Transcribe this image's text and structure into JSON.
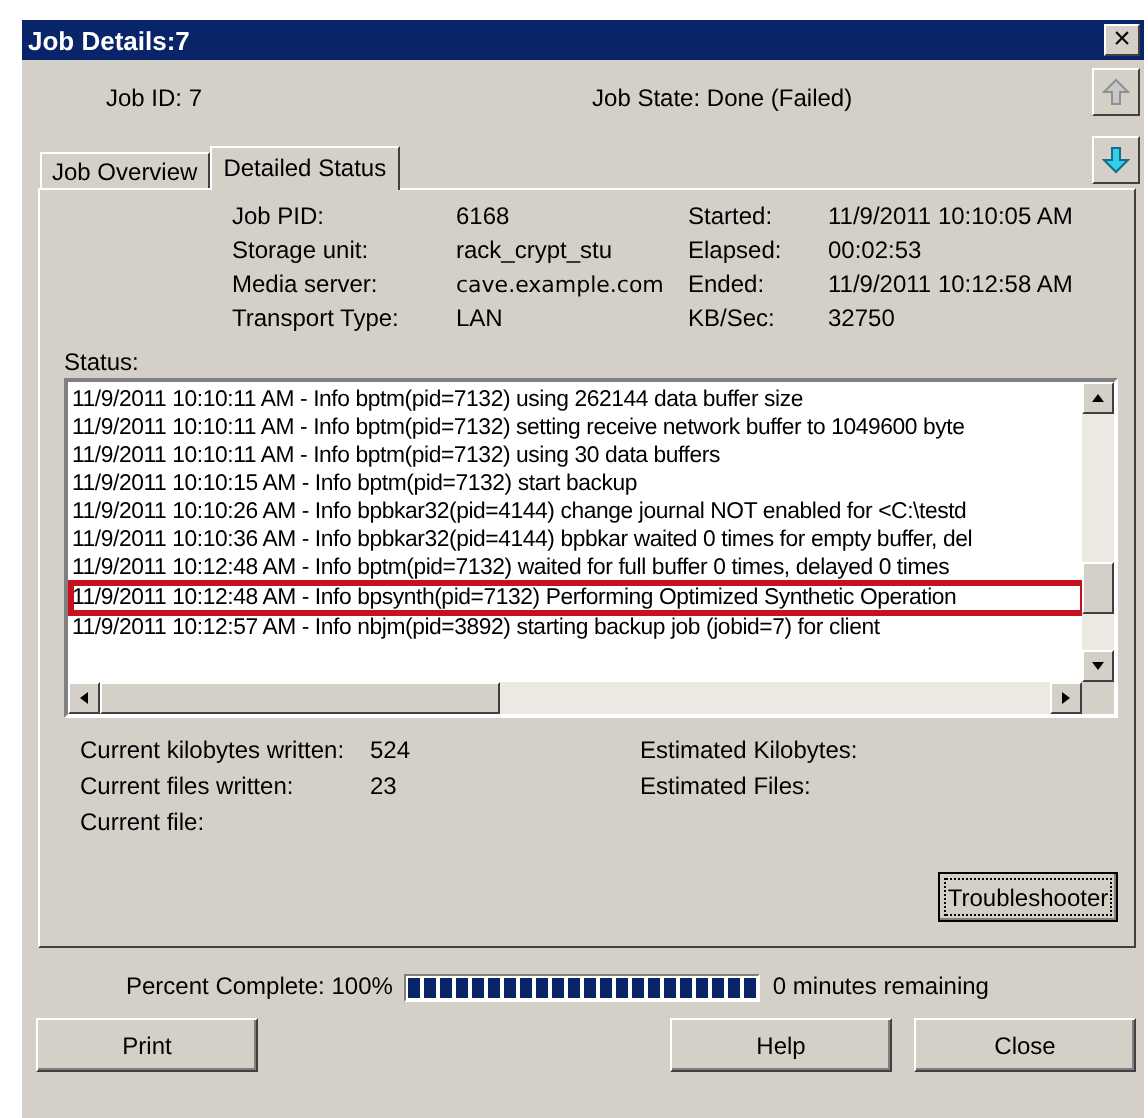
{
  "window": {
    "title": "Job Details:7",
    "close_glyph": "×"
  },
  "header": {
    "job_id": "Job ID: 7",
    "job_state": "Job State: Done (Failed)"
  },
  "tabs": [
    {
      "label": "Job Overview",
      "selected": false
    },
    {
      "label": "Detailed Status",
      "selected": true
    }
  ],
  "details_left": [
    {
      "label": "Job PID:",
      "value": "6168"
    },
    {
      "label": "Storage unit:",
      "value": "rack_crypt_stu"
    },
    {
      "label": "Media server:",
      "value": "cave.example.com"
    },
    {
      "label": "Transport Type:",
      "value": "LAN"
    }
  ],
  "details_right": [
    {
      "label": "Started:",
      "value": "11/9/2011 10:10:05 AM"
    },
    {
      "label": "Elapsed:",
      "value": "00:02:53"
    },
    {
      "label": "Ended:",
      "value": "11/9/2011 10:12:58 AM"
    },
    {
      "label": "KB/Sec:",
      "value": "32750"
    }
  ],
  "status_label": "Status:",
  "status_log": [
    {
      "text": "11/9/2011 10:10:11 AM - Info bptm(pid=7132) using 262144 data buffer size",
      "highlighted": false
    },
    {
      "text": "11/9/2011 10:10:11 AM - Info bptm(pid=7132) setting receive network buffer to 1049600 byte",
      "highlighted": false
    },
    {
      "text": "11/9/2011 10:10:11 AM - Info bptm(pid=7132) using 30 data buffers",
      "highlighted": false
    },
    {
      "text": "11/9/2011 10:10:15 AM - Info bptm(pid=7132) start backup",
      "highlighted": false
    },
    {
      "text": "11/9/2011 10:10:26 AM - Info bpbkar32(pid=4144) change journal NOT enabled for <C:\\testd",
      "highlighted": false
    },
    {
      "text": "11/9/2011 10:10:36 AM - Info bpbkar32(pid=4144) bpbkar waited 0 times for empty buffer, del",
      "highlighted": false
    },
    {
      "text": "11/9/2011 10:12:48 AM - Info bptm(pid=7132) waited for full buffer 0 times, delayed 0 times",
      "highlighted": false
    },
    {
      "text": "11/9/2011 10:12:48 AM - Info bpsynth(pid=7132) Performing Optimized Synthetic Operation",
      "highlighted": true
    },
    {
      "text": "11/9/2011 10:12:57 AM - Info nbjm(pid=3892) starting backup job (jobid=7) for client",
      "highlighted": false
    }
  ],
  "stats_left": [
    {
      "label": "Current kilobytes written:",
      "value": "524"
    },
    {
      "label": "Current files written:",
      "value": "23"
    },
    {
      "label": "Current file:"
    }
  ],
  "stats_right": [
    {
      "label": "Estimated Kilobytes:"
    },
    {
      "label": "Estimated Files:"
    }
  ],
  "troubleshooter": "Troubleshooter",
  "progress": {
    "label": "Percent Complete: 100%",
    "level": 1,
    "remaining": "0 minutes remaining"
  },
  "buttons": [
    {
      "label": "Print",
      "kind": "left"
    },
    {
      "label": "Help",
      "kind": "right"
    },
    {
      "label": "Close",
      "kind": "right"
    }
  ]
}
